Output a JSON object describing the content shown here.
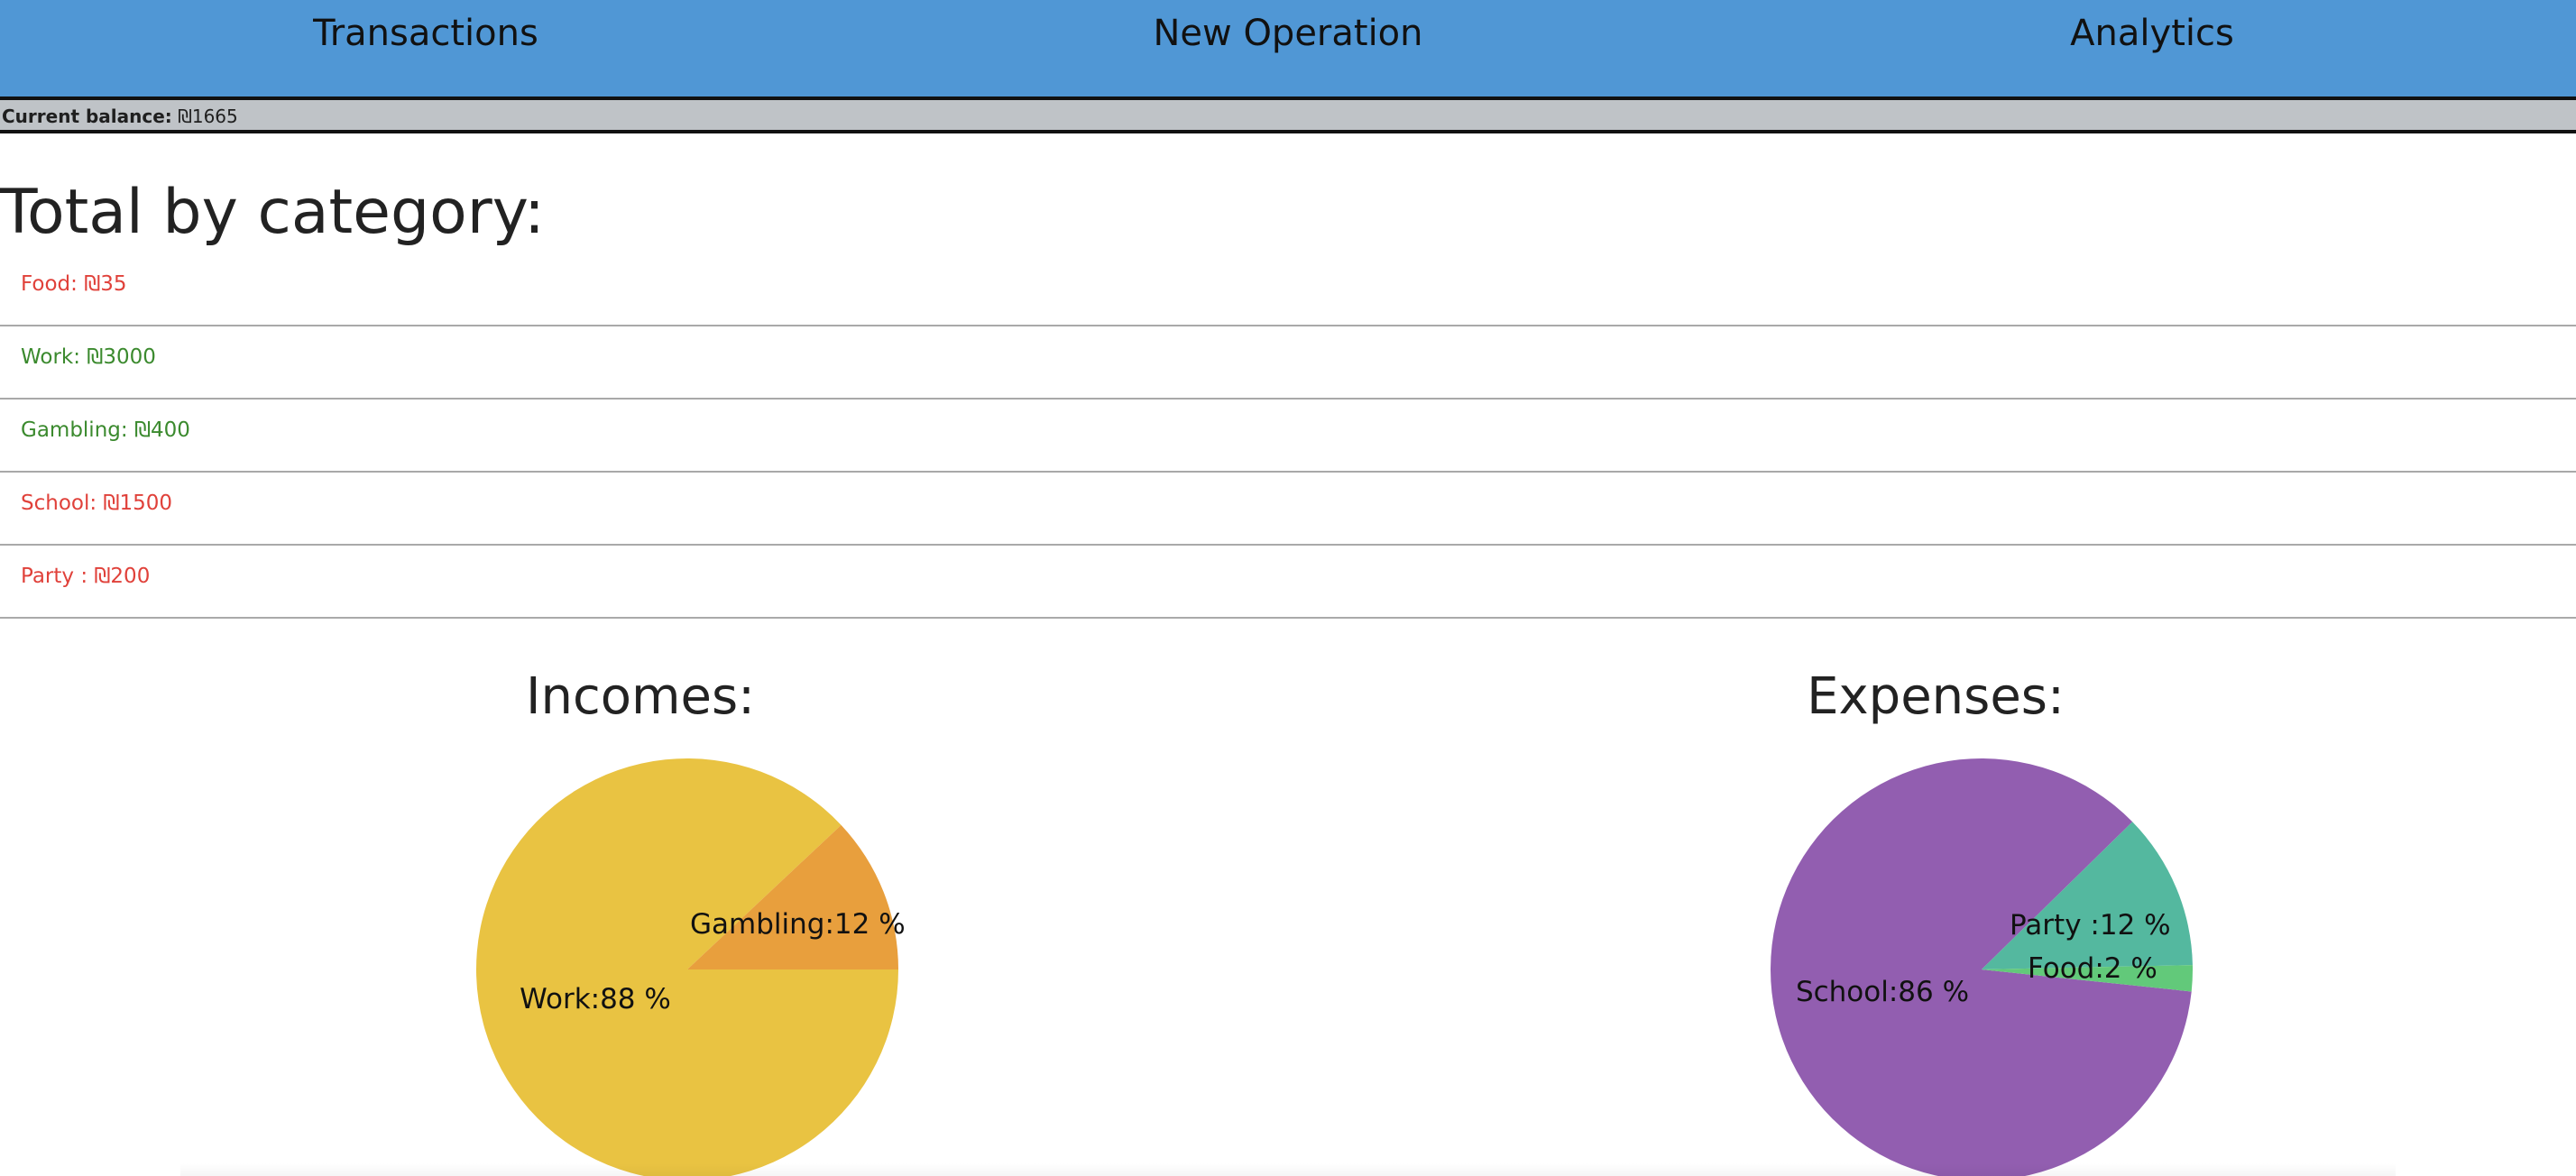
{
  "nav": {
    "items": [
      "Transactions",
      "New Operation",
      "Analytics"
    ]
  },
  "balance": {
    "label": "Current balance:",
    "value": "₪1665"
  },
  "categories_title": "Total by category:",
  "categories": [
    {
      "text": "Food: ₪35",
      "type": "expense"
    },
    {
      "text": "Work: ₪3000",
      "type": "income"
    },
    {
      "text": "Gambling: ₪400",
      "type": "income"
    },
    {
      "text": "School: ₪1500",
      "type": "expense"
    },
    {
      "text": "Party : ₪200",
      "type": "expense"
    }
  ],
  "colors": {
    "nav_bg": "#5097d5",
    "income_text": "#3b8a2e",
    "expense_text": "#e0413a"
  },
  "chart_data": [
    {
      "type": "pie",
      "title": "Incomes:",
      "slices": [
        {
          "name": "Work",
          "label": "Work:88 %",
          "value": 88,
          "color": "#e9c342"
        },
        {
          "name": "Gambling",
          "label": "Gambling:12 %",
          "value": 12,
          "color": "#e89f3d"
        }
      ]
    },
    {
      "type": "pie",
      "title": "Expenses:",
      "slices": [
        {
          "name": "School",
          "label": "School:86 %",
          "value": 86,
          "color": "#925eb0"
        },
        {
          "name": "Party",
          "label": "Party :12 %",
          "value": 12,
          "color": "#54b89f"
        },
        {
          "name": "Food",
          "label": "Food:2 %",
          "value": 2,
          "color": "#62c97a"
        }
      ]
    }
  ]
}
